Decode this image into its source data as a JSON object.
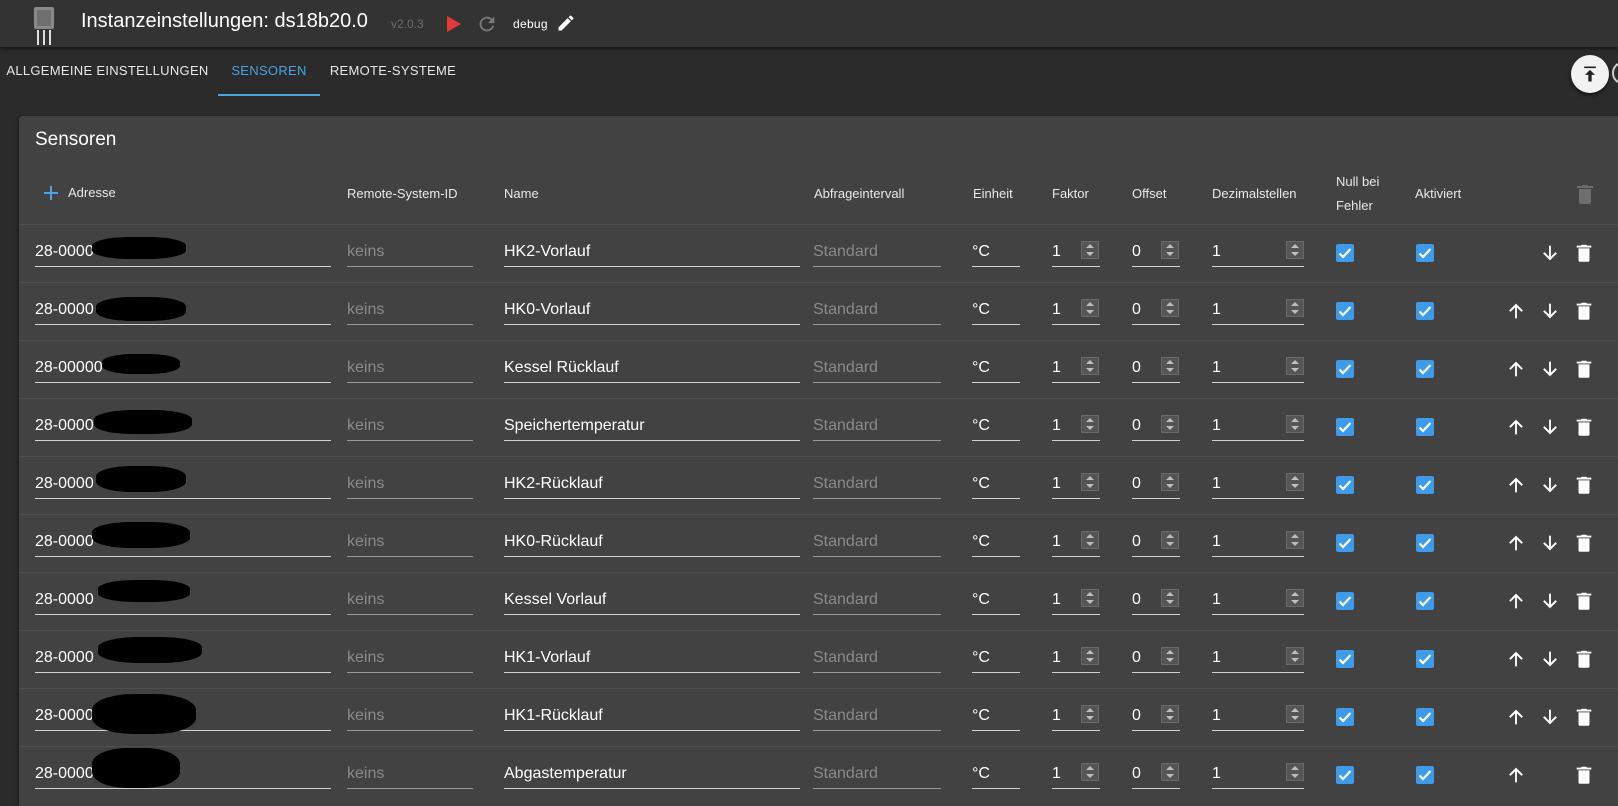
{
  "header": {
    "title": "Instanzeinstellungen: ds18b20.0",
    "version": "v2.0.3",
    "loglevel": "debug",
    "icons": [
      "adapter-logo",
      "play-icon",
      "reload-icon",
      "pencil-icon"
    ]
  },
  "tabs": [
    {
      "label": "ALLGEMEINE EINSTELLUNGEN",
      "active": false
    },
    {
      "label": "SENSOREN",
      "active": true
    },
    {
      "label": "REMOTE-SYSTEME",
      "active": false
    }
  ],
  "panel": {
    "title": "Sensoren",
    "columns": {
      "address": "Adresse",
      "remote_id": "Remote-System-ID",
      "name": "Name",
      "interval": "Abfrageintervall",
      "unit": "Einheit",
      "factor": "Faktor",
      "offset": "Offset",
      "decimals": "Dezimalstellen",
      "null_line1": "Null bei",
      "null_line2": "Fehler",
      "active": "Aktiviert"
    },
    "rows": [
      {
        "address": "28-0000",
        "remote": "keins",
        "name": "HK2-Vorlauf",
        "interval": "Standard",
        "unit": "°C",
        "factor": "1",
        "offset": "0",
        "decimals": "1",
        "null_on_error": true,
        "enabled": true
      },
      {
        "address": "28-0000",
        "remote": "keins",
        "name": "HK0-Vorlauf",
        "interval": "Standard",
        "unit": "°C",
        "factor": "1",
        "offset": "0",
        "decimals": "1",
        "null_on_error": true,
        "enabled": true
      },
      {
        "address": "28-00000",
        "remote": "keins",
        "name": "Kessel Rücklauf",
        "interval": "Standard",
        "unit": "°C",
        "factor": "1",
        "offset": "0",
        "decimals": "1",
        "null_on_error": true,
        "enabled": true
      },
      {
        "address": "28-0000",
        "remote": "keins",
        "name": "Speichertemperatur",
        "interval": "Standard",
        "unit": "°C",
        "factor": "1",
        "offset": "0",
        "decimals": "1",
        "null_on_error": true,
        "enabled": true
      },
      {
        "address": "28-0000",
        "remote": "keins",
        "name": "HK2-Rücklauf",
        "interval": "Standard",
        "unit": "°C",
        "factor": "1",
        "offset": "0",
        "decimals": "1",
        "null_on_error": true,
        "enabled": true
      },
      {
        "address": "28-0000",
        "remote": "keins",
        "name": "HK0-Rücklauf",
        "interval": "Standard",
        "unit": "°C",
        "factor": "1",
        "offset": "0",
        "decimals": "1",
        "null_on_error": true,
        "enabled": true
      },
      {
        "address": "28-0000",
        "remote": "keins",
        "name": "Kessel Vorlauf",
        "interval": "Standard",
        "unit": "°C",
        "factor": "1",
        "offset": "0",
        "decimals": "1",
        "null_on_error": true,
        "enabled": true
      },
      {
        "address": "28-0000",
        "remote": "keins",
        "name": "HK1-Vorlauf",
        "interval": "Standard",
        "unit": "°C",
        "factor": "1",
        "offset": "0",
        "decimals": "1",
        "null_on_error": true,
        "enabled": true
      },
      {
        "address": "28-0000",
        "remote": "keins",
        "name": "HK1-Rücklauf",
        "interval": "Standard",
        "unit": "°C",
        "factor": "1",
        "offset": "0",
        "decimals": "1",
        "null_on_error": true,
        "enabled": true
      },
      {
        "address": "28-0000",
        "remote": "keins",
        "name": "Abgastemperatur",
        "interval": "Standard",
        "unit": "°C",
        "factor": "1",
        "offset": "0",
        "decimals": "1",
        "null_on_error": true,
        "enabled": true
      }
    ]
  },
  "colors": {
    "accent": "#4aa3e3",
    "checkbox": "#3d9be9",
    "play": "#e53935"
  }
}
